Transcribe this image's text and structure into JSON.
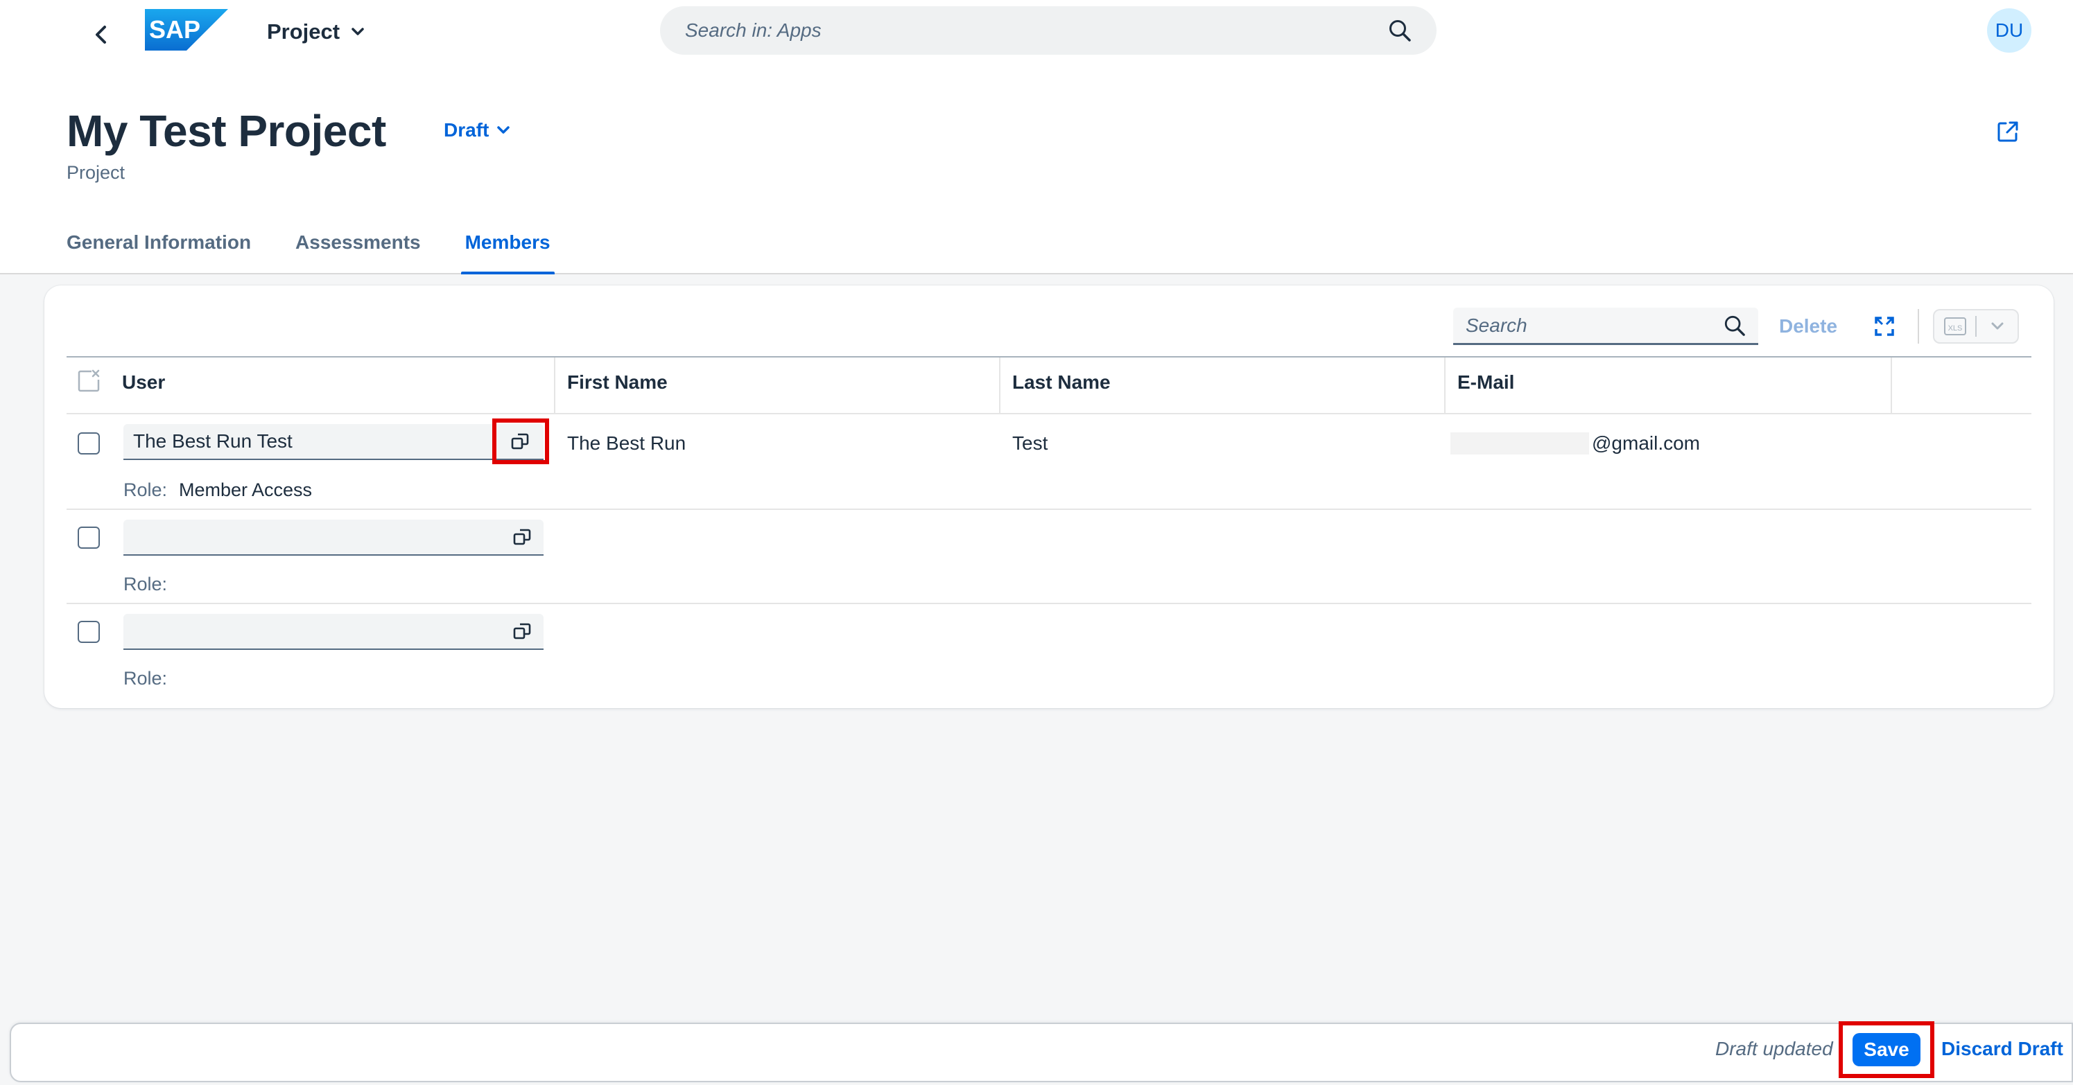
{
  "shell": {
    "logo_text": "SAP",
    "app_title": "Project",
    "search_placeholder": "Search in: Apps",
    "avatar_initials": "DU"
  },
  "header": {
    "title": "My Test Project",
    "status": "Draft",
    "subtitle": "Project"
  },
  "tabs": [
    {
      "label": "General Information",
      "active": false
    },
    {
      "label": "Assessments",
      "active": false
    },
    {
      "label": "Members",
      "active": true
    }
  ],
  "toolbar": {
    "search_placeholder": "Search",
    "delete_label": "Delete",
    "export_label": "XLS"
  },
  "table": {
    "columns": [
      "User",
      "First Name",
      "Last Name",
      "E-Mail"
    ],
    "role_label": "Role:",
    "rows": [
      {
        "user": "The Best Run Test",
        "first_name": "The Best Run",
        "last_name": "Test",
        "email": "@gmail.com",
        "role": "Member Access"
      },
      {
        "user": "",
        "first_name": "",
        "last_name": "",
        "email": "",
        "role": ""
      },
      {
        "user": "",
        "first_name": "",
        "last_name": "",
        "email": "",
        "role": ""
      }
    ]
  },
  "footer": {
    "status": "Draft updated",
    "save_label": "Save",
    "discard_label": "Discard Draft"
  },
  "colors": {
    "accent": "#0064d9",
    "primary_button": "#0070f2",
    "highlight": "#e00000"
  }
}
